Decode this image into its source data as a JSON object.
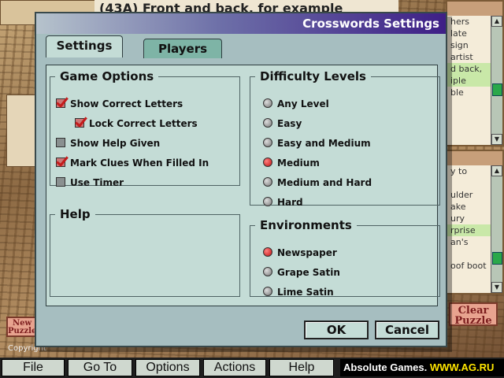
{
  "background": {
    "puzzle_title": "(43A) Front and back, for example",
    "across_clues": [
      "hers",
      "late",
      "sign",
      "artist",
      "d back,",
      "iple",
      "ble"
    ],
    "down_clues": [
      "y to",
      "",
      "ulder",
      "ake",
      "ury",
      "rprise",
      "an's",
      "",
      "oof boot"
    ],
    "new_puzzle_label": "New Puzzle",
    "clear_puzzle_label": "Clear Puzzle",
    "copyright": "Copyright"
  },
  "dialog": {
    "title": "Crosswords Settings",
    "tabs": [
      {
        "label": "Settings",
        "active": true
      },
      {
        "label": "Players",
        "active": false
      }
    ],
    "game_options": {
      "label": "Game Options",
      "items": [
        {
          "label": "Show Correct Letters",
          "checked": true
        },
        {
          "label": "Lock Correct Letters",
          "checked": true
        },
        {
          "label": "Show Help Given",
          "checked": false
        },
        {
          "label": "Mark Clues When Filled In",
          "checked": true
        },
        {
          "label": "Use Timer",
          "checked": false
        }
      ]
    },
    "help": {
      "label": "Help"
    },
    "difficulty": {
      "label": "Difficulty Levels",
      "options": [
        "Any Level",
        "Easy",
        "Easy and Medium",
        "Medium",
        "Medium and Hard",
        "Hard"
      ],
      "selected": "Medium"
    },
    "environments": {
      "label": "Environments",
      "options": [
        "Newspaper",
        "Grape Satin",
        "Lime Satin"
      ],
      "selected": "Newspaper"
    },
    "ok_label": "OK",
    "cancel_label": "Cancel"
  },
  "menubar": {
    "items": [
      "File",
      "Go To",
      "Options",
      "Actions",
      "Help"
    ],
    "brand_prefix": "Absolute Games.",
    "brand_url": "WWW.AG.RU"
  },
  "colors": {
    "accent_red": "#c41c1c",
    "panel": "#c4dcd6",
    "title_gradient_end": "#3e1f86",
    "scroll_thumb": "#2aa84a"
  }
}
